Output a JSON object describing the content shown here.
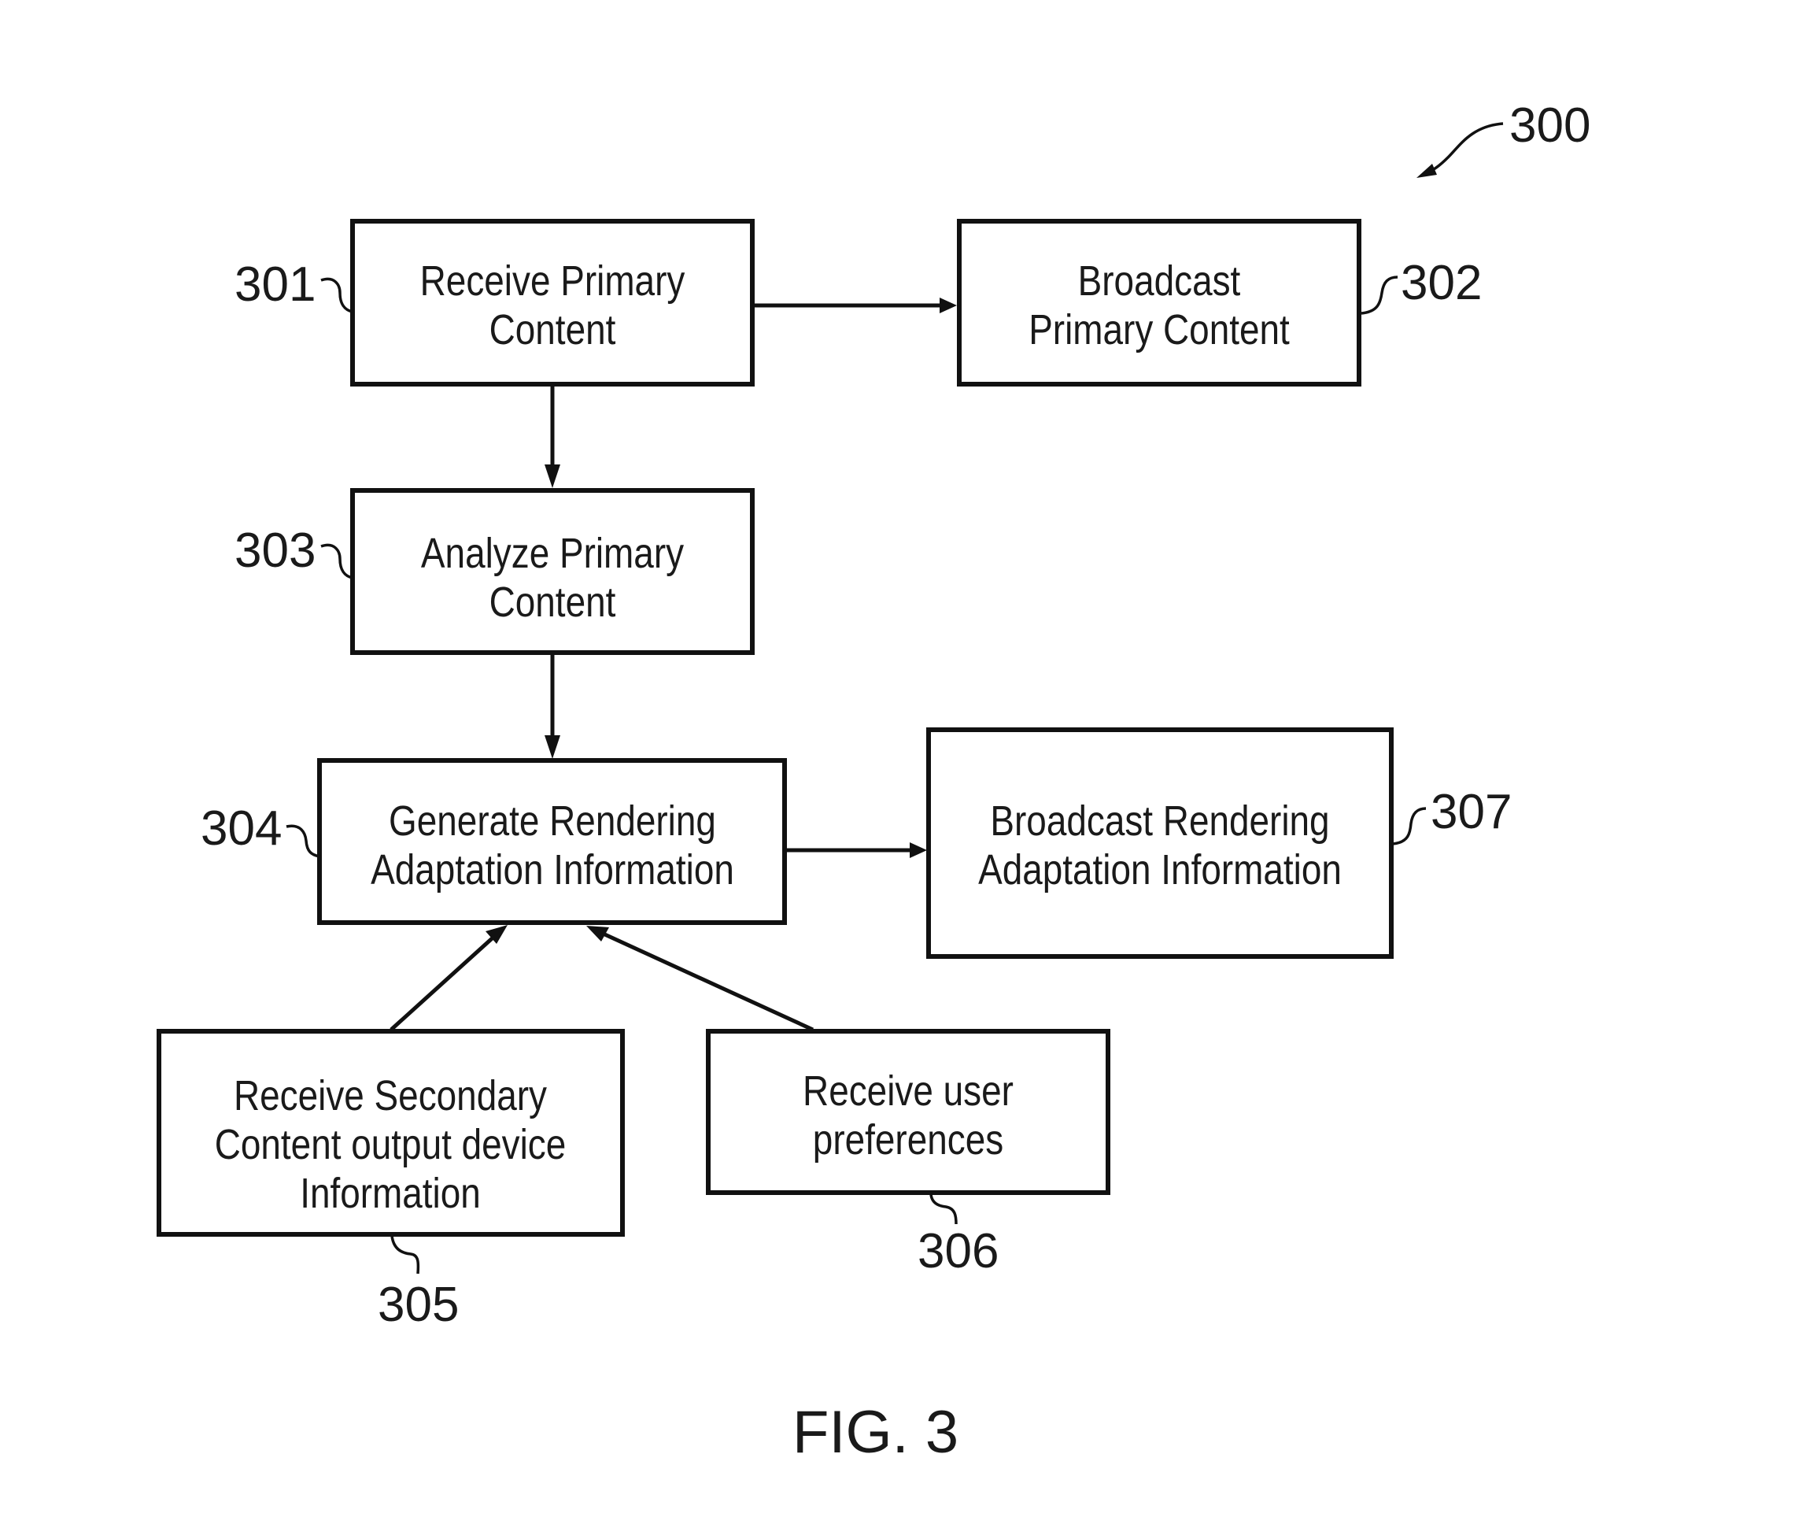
{
  "figure": {
    "label": "FIG. 3",
    "reference": "300"
  },
  "nodes": [
    {
      "id": "301",
      "ref": "301",
      "lines": [
        "Receive Primary",
        "Content"
      ]
    },
    {
      "id": "302",
      "ref": "302",
      "lines": [
        "Broadcast",
        "Primary Content"
      ]
    },
    {
      "id": "303",
      "ref": "303",
      "lines": [
        "Analyze Primary",
        "Content"
      ]
    },
    {
      "id": "304",
      "ref": "304",
      "lines": [
        "Generate Rendering",
        "Adaptation Information"
      ]
    },
    {
      "id": "305",
      "ref": "305",
      "lines": [
        "Receive Secondary",
        "Content output device",
        "Information"
      ]
    },
    {
      "id": "306",
      "ref": "306",
      "lines": [
        "Receive user",
        "preferences"
      ]
    },
    {
      "id": "307",
      "ref": "307",
      "lines": [
        "Broadcast Rendering",
        "Adaptation Information"
      ]
    }
  ],
  "edges": [
    {
      "from": "301",
      "to": "302"
    },
    {
      "from": "301",
      "to": "303"
    },
    {
      "from": "303",
      "to": "304"
    },
    {
      "from": "304",
      "to": "307"
    },
    {
      "from": "305",
      "to": "304"
    },
    {
      "from": "306",
      "to": "304"
    }
  ]
}
